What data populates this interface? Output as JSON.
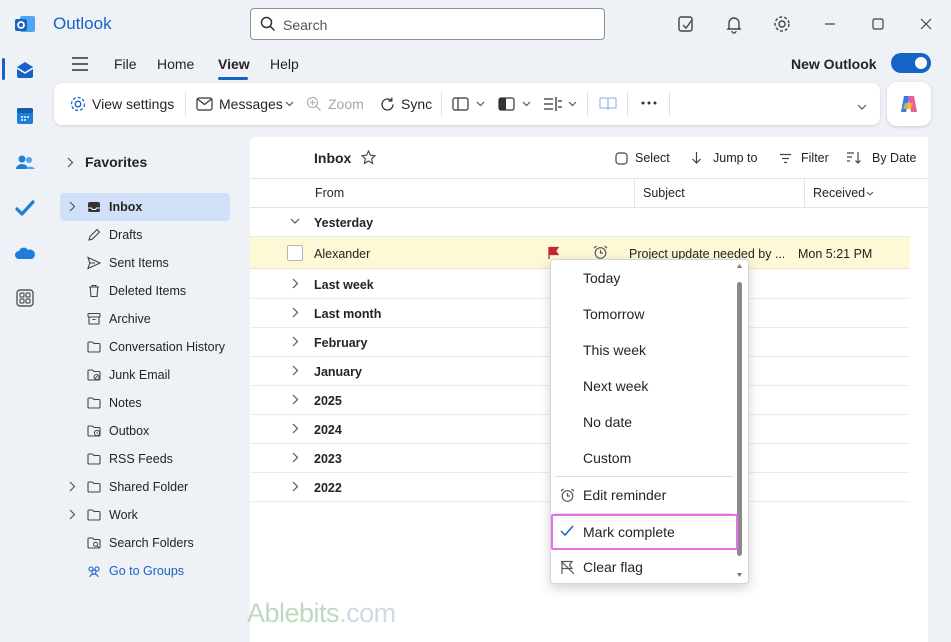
{
  "app": {
    "title": "Outlook"
  },
  "search": {
    "placeholder": "Search"
  },
  "titlebar_icons": [
    "notes-icon",
    "bell-icon",
    "gear-icon",
    "minimize-icon",
    "maximize-icon",
    "close-icon"
  ],
  "rail": [
    "mail-icon",
    "calendar-icon",
    "people-icon",
    "todo-icon",
    "onedrive-icon",
    "apps-icon"
  ],
  "menu": {
    "items": [
      "File",
      "Home",
      "View",
      "Help"
    ],
    "active": "View",
    "new_outlook_label": "New Outlook",
    "new_outlook_on": true
  },
  "ribbon": {
    "view_settings": "View settings",
    "messages": "Messages",
    "zoom": "Zoom",
    "sync": "Sync"
  },
  "folders": {
    "favorites": "Favorites",
    "items": [
      {
        "label": "Inbox",
        "icon": "inbox-icon",
        "selected": true,
        "expandable": true
      },
      {
        "label": "Drafts",
        "icon": "pencil-icon"
      },
      {
        "label": "Sent Items",
        "icon": "send-icon"
      },
      {
        "label": "Deleted Items",
        "icon": "trash-icon"
      },
      {
        "label": "Archive",
        "icon": "archive-icon"
      },
      {
        "label": "Conversation History",
        "icon": "folder-icon"
      },
      {
        "label": "Junk Email",
        "icon": "junk-icon"
      },
      {
        "label": "Notes",
        "icon": "folder-icon"
      },
      {
        "label": "Outbox",
        "icon": "outbox-icon"
      },
      {
        "label": "RSS Feeds",
        "icon": "folder-icon"
      },
      {
        "label": "Shared Folder",
        "icon": "folder-icon",
        "expandable": true
      },
      {
        "label": "Work",
        "icon": "folder-icon",
        "expandable": true
      },
      {
        "label": "Search Folders",
        "icon": "search-folder-icon"
      },
      {
        "label": "Go to Groups",
        "icon": "groups-icon",
        "link": true
      }
    ]
  },
  "list": {
    "title": "Inbox",
    "actions": {
      "select": "Select",
      "jump": "Jump to",
      "filter": "Filter",
      "sort": "By Date"
    },
    "columns": {
      "from": "From",
      "subject": "Subject",
      "received": "Received"
    },
    "first_group": "Yesterday",
    "message": {
      "sender": "Alexander",
      "subject": "Project update needed by ...",
      "received": "Mon 5:21 PM",
      "flag_color": "#c4262e"
    },
    "groups": [
      "Last week",
      "Last month",
      "February",
      "January",
      "2025",
      "2024",
      "2023",
      "2022"
    ]
  },
  "flag_menu": {
    "items": [
      "Today",
      "Tomorrow",
      "This week",
      "Next week",
      "No date",
      "Custom"
    ],
    "edit_reminder": "Edit reminder",
    "mark_complete": "Mark complete",
    "clear_flag": "Clear flag"
  },
  "watermark": {
    "brand": "Ablebits",
    "domain": ".com"
  },
  "colors": {
    "accent": "#1663c7",
    "highlight_row": "#fdf8d6",
    "selected_folder": "#cfe0f8",
    "focus_outline": "#e570e7"
  }
}
